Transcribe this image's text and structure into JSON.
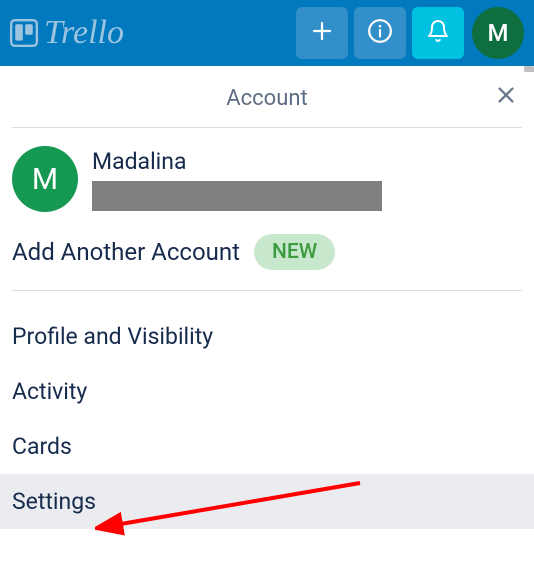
{
  "header": {
    "logo_text": "Trello",
    "avatar_initial": "M"
  },
  "panel": {
    "title": "Account",
    "user": {
      "avatar_initial": "M",
      "name": "Madalina"
    },
    "add_account_label": "Add Another Account",
    "new_badge": "NEW",
    "menu": {
      "profile": "Profile and Visibility",
      "activity": "Activity",
      "cards": "Cards",
      "settings": "Settings"
    }
  }
}
